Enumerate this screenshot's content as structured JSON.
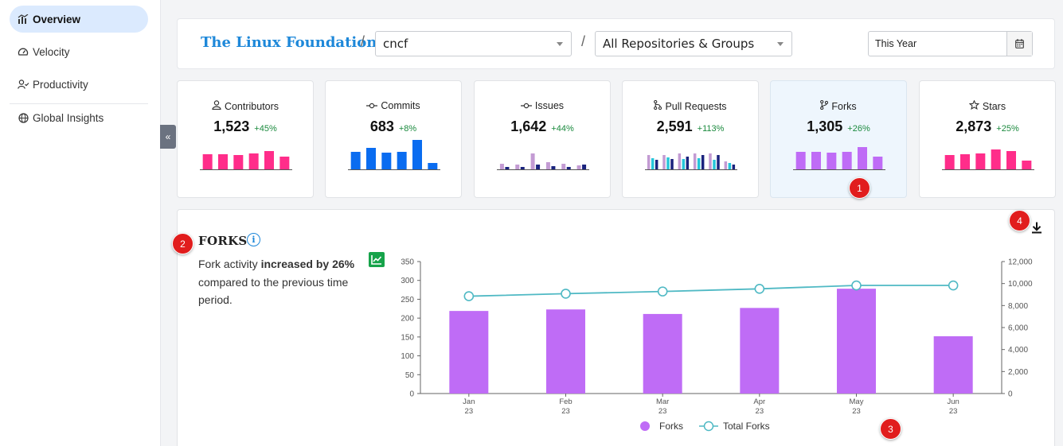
{
  "sidebar": {
    "items": [
      {
        "label": "Overview",
        "icon": "chart-bars-icon",
        "active": true
      },
      {
        "label": "Velocity",
        "icon": "speedometer-icon",
        "active": false
      },
      {
        "label": "Productivity",
        "icon": "user-check-icon",
        "active": false
      },
      {
        "label": "Global Insights",
        "icon": "globe-icon",
        "active": false
      }
    ]
  },
  "header": {
    "org": "The Linux Foundation",
    "separator": "/",
    "project": "cncf",
    "repos": "All Repositories & Groups",
    "date_range": "This Year"
  },
  "metrics": [
    {
      "label": "Contributors",
      "icon": "user-icon",
      "value": "1,523",
      "change": "+45%",
      "spark": [
        [
          19
        ],
        [
          19
        ],
        [
          18
        ],
        [
          20
        ],
        [
          23
        ],
        [
          16
        ]
      ],
      "colors": [
        "#ff2d8a"
      ]
    },
    {
      "label": "Commits",
      "icon": "commit-icon",
      "value": "683",
      "change": "+8%",
      "spark": [
        [
          22
        ],
        [
          27
        ],
        [
          21
        ],
        [
          22
        ],
        [
          37
        ],
        [
          8
        ]
      ],
      "colors": [
        "#0a6cf0"
      ]
    },
    {
      "label": "Issues",
      "icon": "commit-icon",
      "value": "1,642",
      "change": "+44%",
      "spark": [
        [
          7,
          3
        ],
        [
          6,
          3
        ],
        [
          20,
          6
        ],
        [
          9,
          4
        ],
        [
          7,
          3
        ],
        [
          5,
          6
        ]
      ],
      "colors": [
        "#c39bd3",
        "#1a237e"
      ]
    },
    {
      "label": "Pull Requests",
      "icon": "pull-request-icon",
      "value": "2,591",
      "change": "+113%",
      "spark": [
        [
          18,
          14,
          12
        ],
        [
          18,
          15,
          13
        ],
        [
          20,
          13,
          16
        ],
        [
          20,
          14,
          18
        ],
        [
          20,
          12,
          18
        ],
        [
          10,
          8,
          6
        ]
      ],
      "colors": [
        "#c39bd3",
        "#26c6da",
        "#1a237e"
      ]
    },
    {
      "label": "Forks",
      "icon": "fork-icon",
      "value": "1,305",
      "change": "+26%",
      "spark": [
        [
          22
        ],
        [
          22
        ],
        [
          21
        ],
        [
          22
        ],
        [
          28
        ],
        [
          16
        ]
      ],
      "colors": [
        "#bf6cf6"
      ]
    },
    {
      "label": "Stars",
      "icon": "star-icon",
      "value": "2,873",
      "change": "+25%",
      "spark": [
        [
          18
        ],
        [
          19
        ],
        [
          20
        ],
        [
          25
        ],
        [
          23
        ],
        [
          11
        ]
      ],
      "colors": [
        "#ff2d8a"
      ]
    }
  ],
  "forks_panel": {
    "title": "FORKS",
    "info_icon": "i",
    "desc_pre": "Fork activity ",
    "desc_bold": "increased by 26%",
    "desc_post": " compared to the previous time period.",
    "trend_icon": "trend-up-icon",
    "download_icon": "download-icon"
  },
  "markers": [
    "1",
    "2",
    "3",
    "4"
  ],
  "chart_data": {
    "type": "bar",
    "categories": [
      "Jan\n23",
      "Feb\n23",
      "Mar\n23",
      "Apr\n23",
      "May\n23",
      "Jun\n23"
    ],
    "series": [
      {
        "name": "Forks",
        "type": "bar",
        "axis": "left",
        "color": "#bf6cf6",
        "values": [
          219,
          223,
          211,
          227,
          278,
          152
        ]
      },
      {
        "name": "Total Forks",
        "type": "line",
        "axis": "right",
        "color": "#4fb9c4",
        "values": [
          8850,
          9080,
          9280,
          9520,
          9830,
          9830
        ]
      }
    ],
    "ylim": [
      0,
      350
    ],
    "yticks": [
      0,
      50,
      100,
      150,
      200,
      250,
      300,
      350
    ],
    "y2lim": [
      0,
      12000
    ],
    "y2ticks": [
      "0",
      "2,000",
      "4,000",
      "6,000",
      "8,000",
      "10,000",
      "12,000"
    ],
    "legend": "bottom",
    "grid": false
  }
}
